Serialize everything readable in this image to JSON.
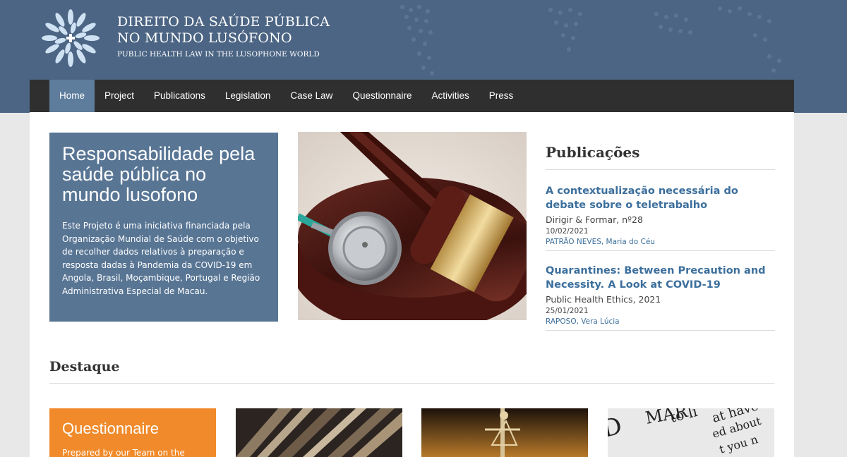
{
  "header": {
    "title_line1": "DIREITO DA SAÚDE PÚBLICA",
    "title_line2": "NO MUNDO LUSÓFONO",
    "subtitle": "PUBLIC HEALTH LAW IN THE LUSOPHONE WORLD"
  },
  "nav": {
    "items": [
      "Home",
      "Project",
      "Publications",
      "Legislation",
      "Case Law",
      "Questionnaire",
      "Activities",
      "Press"
    ],
    "active": "Home"
  },
  "hero": {
    "title": "Responsabilidade pela saúde pública no mundo lusofono",
    "text": "Este Projeto é uma iniciativa financiada pela Organização Mundial de Saúde com o objetivo de recolher dados relativos à preparação e resposta dadas à Pandemia da COVID-19 em Angola, Brasil, Moçambique, Portugal e Região Administrativa Especial de Macau."
  },
  "publications": {
    "heading": "Publicações",
    "items": [
      {
        "title": "A contextualização necessária do debate sobre o teletrabalho",
        "source": "Dirigir & Formar, nº28",
        "date": "10/02/2021",
        "author": "PATRÃO NEVES, Maria do Céu"
      },
      {
        "title": "Quarantines: Between Precaution and Necessity. A Look at COVID-19",
        "source": "Public Health Ethics, 2021",
        "date": "25/01/2021",
        "author": "RAPOSO, Vera Lúcia"
      }
    ]
  },
  "destaque": {
    "heading": "Destaque",
    "card1_title": "Questionnaire",
    "card1_text": "Prepared by our Team on the"
  },
  "colors": {
    "header_bg": "#4c6584",
    "nav_bg": "#2f2f2f",
    "nav_active": "#5e7c9b",
    "hero_bg": "#587594",
    "link": "#3c6f9c",
    "orange": "#f08a2a"
  }
}
